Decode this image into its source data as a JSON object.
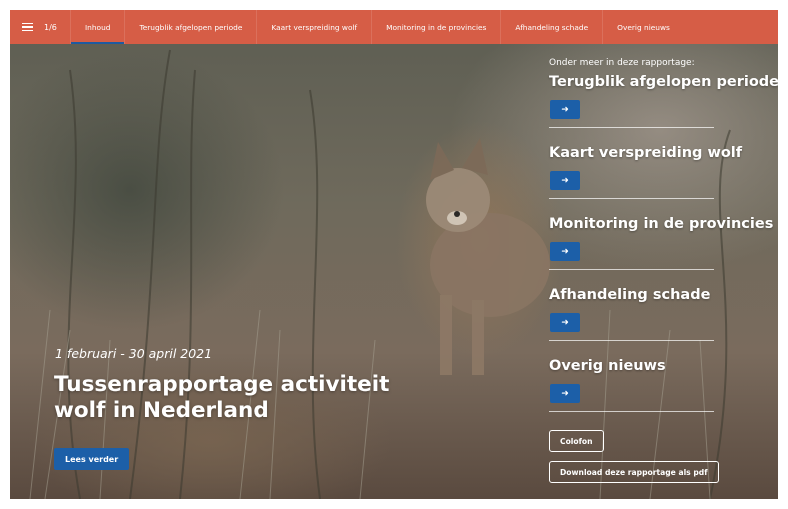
{
  "nav": {
    "page_counter": "1/6",
    "tabs": [
      {
        "label": "Inhoud"
      },
      {
        "label": "Terugblik afgelopen periode"
      },
      {
        "label": "Kaart verspreiding wolf"
      },
      {
        "label": "Monitoring in de provincies"
      },
      {
        "label": "Afhandeling schade"
      },
      {
        "label": "Overig nieuws"
      }
    ]
  },
  "hero": {
    "date": "1 februari - 30 april 2021",
    "title": "Tussenrapportage activiteit wolf in Nederland",
    "read_more": "Lees verder"
  },
  "side": {
    "intro": "Onder meer in deze rapportage:",
    "items": [
      {
        "title": "Terugblik afgelopen periode"
      },
      {
        "title": "Kaart verspreiding wolf"
      },
      {
        "title": "Monitoring in de provincies"
      },
      {
        "title": "Afhandeling schade"
      },
      {
        "title": "Overig nieuws"
      }
    ],
    "arrow": "➜",
    "colofon": "Colofon",
    "download": "Download deze rapportage als pdf"
  },
  "colors": {
    "nav_background": "#d65d46",
    "button_blue": "#1c5fa8"
  }
}
